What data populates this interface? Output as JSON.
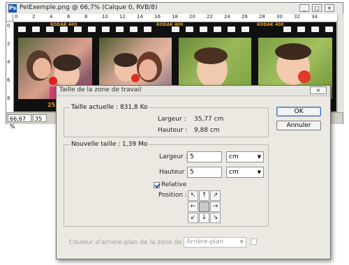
{
  "document": {
    "title": "PelExemple.png @ 66,7% (Calque 0, RVB/8)",
    "ps_icon": "Ps",
    "window_buttons": [
      "_",
      "□",
      "×"
    ],
    "ruler_top_ticks": [
      "0",
      "2",
      "4",
      "6",
      "8",
      "10",
      "12",
      "14",
      "16",
      "18",
      "20",
      "22",
      "24",
      "26",
      "28",
      "30",
      "32",
      "34"
    ],
    "ruler_left_ticks": [
      "0",
      "2",
      "4",
      "6",
      "8"
    ],
    "frame_labels": [
      "KODAK 400",
      "KODAK 400",
      "KODAK 400"
    ],
    "frame_number": "25",
    "zoom": "66,67 %",
    "status_value": "35"
  },
  "dialog": {
    "title": "Taille de la zone de travail",
    "close_label": "×",
    "current_size": {
      "title": "Taille actuelle : 831,8 Ko",
      "width_label": "Largeur :",
      "width_value": "35,77 cm",
      "height_label": "Hauteur :",
      "height_value": "9,88 cm"
    },
    "new_size": {
      "title": "Nouvelle taille : 1,39 Mo",
      "width_label": "Largeur :",
      "width_value": "5",
      "width_unit": "cm",
      "height_label": "Hauteur :",
      "height_value": "5",
      "height_unit": "cm",
      "relative_label": "Relative",
      "relative_checked": true,
      "position_label": "Position :",
      "anchor": [
        "↖",
        "↑",
        "↗",
        "←",
        "",
        "→",
        "↙",
        "↓",
        "↘"
      ]
    },
    "bg_color_label": "Couleur d'arrière-plan de la zone de travail :",
    "bg_color_value": "Arrière-plan",
    "ok_label": "OK",
    "cancel_label": "Annuler"
  }
}
